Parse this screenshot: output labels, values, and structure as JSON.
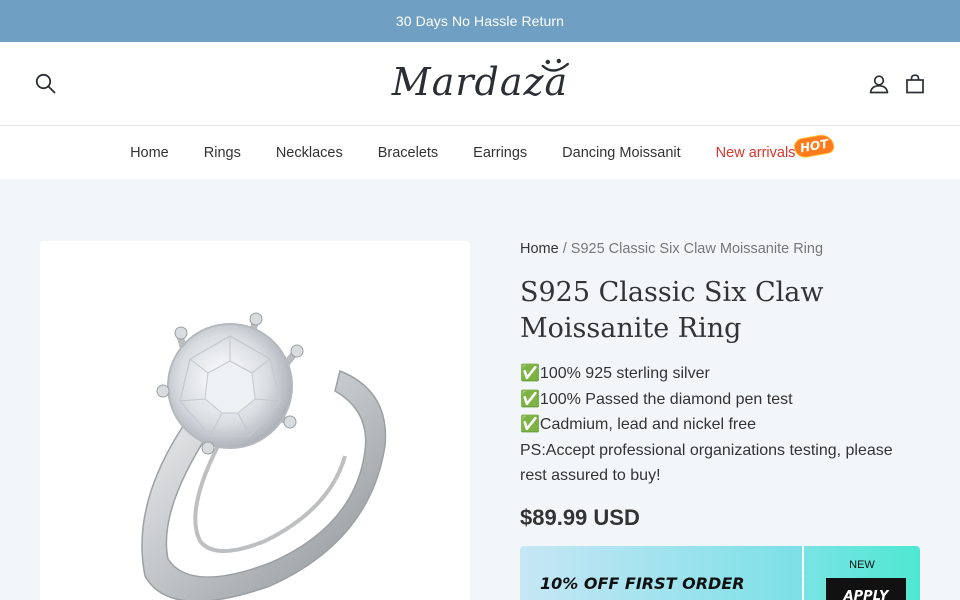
{
  "announcement": "30 Days No Hassle Return",
  "brand": {
    "logo_text": "Mardaza"
  },
  "nav": {
    "items": [
      "Home",
      "Rings",
      "Necklaces",
      "Bracelets",
      "Earrings",
      "Dancing Moissanit"
    ],
    "new_arrivals": "New arrivals",
    "hot_badge": "HOT"
  },
  "breadcrumb": {
    "home": "Home",
    "separator": "/",
    "current": "S925 Classic Six Claw Moissanite Ring"
  },
  "product": {
    "title": "S925 Classic Six Claw Moissanite Ring",
    "features": [
      "✅100% 925 sterling silver",
      "✅100% Passed the diamond pen test",
      "✅Cadmium, lead and nickel free",
      "PS:Accept professional organizations testing, please rest assured to buy!"
    ],
    "price": "$89.99 USD"
  },
  "coupon": {
    "headline": "10% OFF FIRST ORDER",
    "tag": "NEW",
    "button": "APPLY"
  },
  "colors": {
    "announcement_bg": "#6f9fc2",
    "new_arrivals": "#d9352a"
  },
  "icons": [
    "search-icon",
    "account-icon",
    "cart-icon"
  ]
}
